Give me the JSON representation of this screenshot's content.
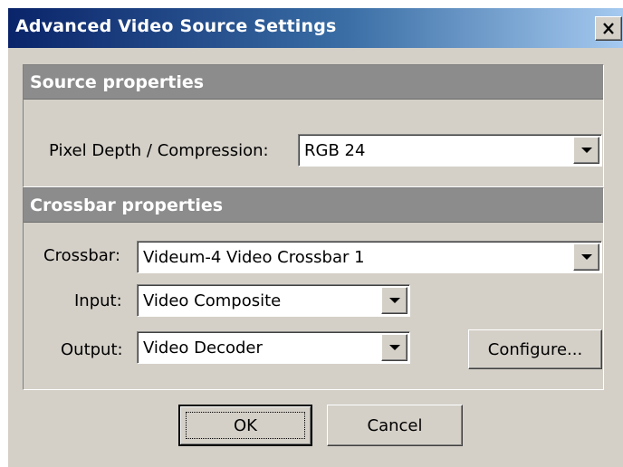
{
  "window": {
    "title": "Advanced Video Source Settings",
    "close_glyph": "✕"
  },
  "source_panel": {
    "header": "Source properties",
    "pixel_depth_label": "Pixel Depth / Compression:",
    "pixel_depth_value": "RGB 24"
  },
  "crossbar_panel": {
    "header": "Crossbar properties",
    "crossbar_label": "Crossbar:",
    "crossbar_value": "Videum-4 Video Crossbar 1",
    "input_label": "Input:",
    "input_value": "Video Composite",
    "output_label": "Output:",
    "output_value": "Video Decoder",
    "configure_label": "Configure..."
  },
  "footer": {
    "ok_label": "OK",
    "cancel_label": "Cancel"
  },
  "icons": [
    "close-icon",
    "chevron-down-icon"
  ],
  "colors": {
    "titlebar_start": "#0a246a",
    "titlebar_end": "#a6caf0",
    "dialog_face": "#d4d0c8",
    "section_header": "#8c8c8c"
  }
}
